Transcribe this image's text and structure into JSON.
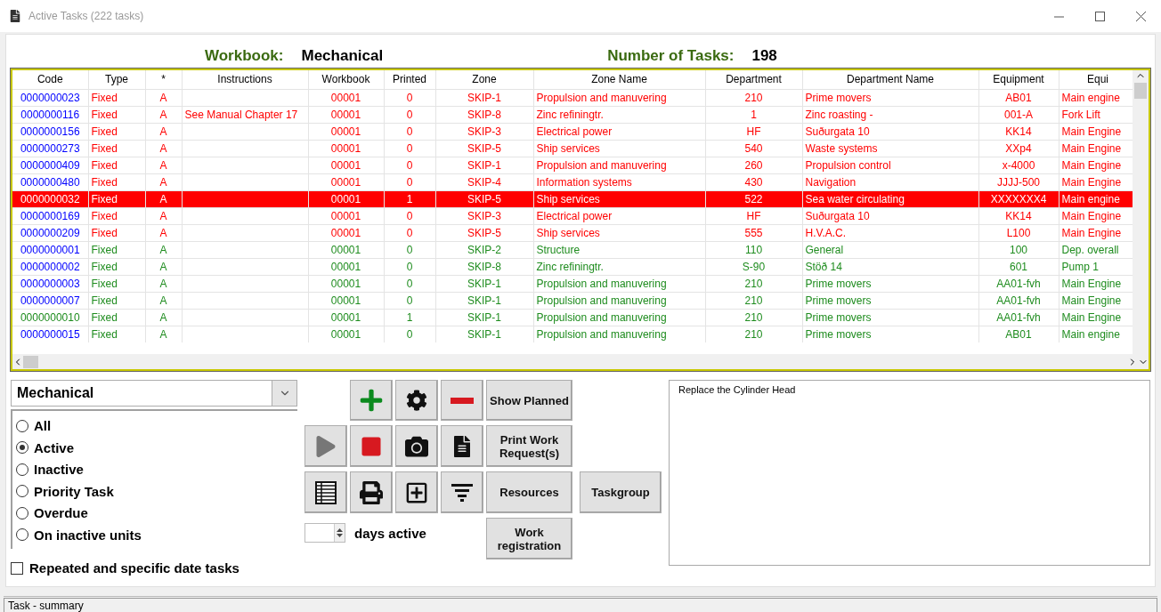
{
  "window": {
    "title": "Active Tasks (222 tasks)"
  },
  "header": {
    "workbook_label": "Workbook:",
    "workbook_value": "Mechanical",
    "count_label": "Number of Tasks:",
    "count_value": "198"
  },
  "table": {
    "columns": [
      "Code",
      "Type",
      "*",
      "Instructions",
      "Workbook",
      "Printed",
      "Zone",
      "Zone Name",
      "Department",
      "Department Name",
      "Equipment",
      "Equi"
    ],
    "rows": [
      {
        "selected": false,
        "color": "#ff0000",
        "code_highlighted": true,
        "cells": [
          "0000000023",
          "Fixed",
          "A",
          "",
          "00001",
          "0",
          "SKIP-1",
          "Propulsion and manuvering",
          "210",
          "Prime movers",
          "AB01",
          "Main engine"
        ]
      },
      {
        "selected": false,
        "color": "#ff0000",
        "code_highlighted": true,
        "cells": [
          "0000000116",
          "Fixed",
          "A",
          "See Manual Chapter 17",
          "00001",
          "0",
          "SKIP-8",
          "Zinc refiningtr.",
          "1",
          "Zinc roasting -",
          "001-A",
          "Fork Lift"
        ]
      },
      {
        "selected": false,
        "color": "#ff0000",
        "code_highlighted": true,
        "cells": [
          "0000000156",
          "Fixed",
          "A",
          "",
          "00001",
          "0",
          "SKIP-3",
          "Electrical power",
          "HF",
          "Suðurgata 10",
          "KK14",
          "Main Engine"
        ]
      },
      {
        "selected": false,
        "color": "#ff0000",
        "code_highlighted": true,
        "cells": [
          "0000000273",
          "Fixed",
          "A",
          "",
          "00001",
          "0",
          "SKIP-5",
          "Ship services",
          "540",
          "Waste systems",
          "XXp4",
          "Main Engine"
        ]
      },
      {
        "selected": false,
        "color": "#ff0000",
        "code_highlighted": true,
        "cells": [
          "0000000409",
          "Fixed",
          "A",
          "",
          "00001",
          "0",
          "SKIP-1",
          "Propulsion and manuvering",
          "260",
          "Propulsion control",
          "x-4000",
          "Main Engine"
        ]
      },
      {
        "selected": false,
        "color": "#ff0000",
        "code_highlighted": true,
        "cells": [
          "0000000480",
          "Fixed",
          "A",
          "",
          "00001",
          "0",
          "SKIP-4",
          "Information systems",
          "430",
          "Navigation",
          "JJJJ-500",
          "Main Engine"
        ]
      },
      {
        "selected": true,
        "color": "#ff0000",
        "code_highlighted": true,
        "cells": [
          "0000000032",
          "Fixed",
          "A",
          "",
          "00001",
          "1",
          "SKIP-5",
          "Ship services",
          "522",
          "Sea water circulating",
          "XXXXXXX4",
          "Main engine"
        ]
      },
      {
        "selected": false,
        "color": "#ff0000",
        "code_highlighted": true,
        "cells": [
          "0000000169",
          "Fixed",
          "A",
          "",
          "00001",
          "0",
          "SKIP-3",
          "Electrical power",
          "HF",
          "Suðurgata 10",
          "KK14",
          "Main Engine"
        ]
      },
      {
        "selected": false,
        "color": "#ff0000",
        "code_highlighted": true,
        "cells": [
          "0000000209",
          "Fixed",
          "A",
          "",
          "00001",
          "0",
          "SKIP-5",
          "Ship services",
          "555",
          "H.V.A.C.",
          "L100",
          "Main Engine"
        ]
      },
      {
        "selected": false,
        "color": "#1e8c1e",
        "code_highlighted": true,
        "cells": [
          "0000000001",
          "Fixed",
          "A",
          "",
          "00001",
          "0",
          "SKIP-2",
          "Structure",
          "110",
          "General",
          "100",
          "Dep. overall"
        ]
      },
      {
        "selected": false,
        "color": "#1e8c1e",
        "code_highlighted": true,
        "cells": [
          "0000000002",
          "Fixed",
          "A",
          "",
          "00001",
          "0",
          "SKIP-8",
          "Zinc refiningtr.",
          "S-90",
          "Stöð  14",
          "601",
          "Pump 1"
        ]
      },
      {
        "selected": false,
        "color": "#1e8c1e",
        "code_highlighted": true,
        "cells": [
          "0000000003",
          "Fixed",
          "A",
          "",
          "00001",
          "0",
          "SKIP-1",
          "Propulsion and manuvering",
          "210",
          "Prime movers",
          "AA01-fvh",
          "Main Engine"
        ]
      },
      {
        "selected": false,
        "color": "#1e8c1e",
        "code_highlighted": true,
        "cells": [
          "0000000007",
          "Fixed",
          "A",
          "",
          "00001",
          "0",
          "SKIP-1",
          "Propulsion and manuvering",
          "210",
          "Prime movers",
          "AA01-fvh",
          "Main Engine"
        ]
      },
      {
        "selected": false,
        "color": "#1e8c1e",
        "code_highlighted": false,
        "cells": [
          "0000000010",
          "Fixed",
          "A",
          "",
          "00001",
          "1",
          "SKIP-1",
          "Propulsion and manuvering",
          "210",
          "Prime movers",
          "AA01-fvh",
          "Main Engine"
        ]
      },
      {
        "selected": false,
        "color": "#1e8c1e",
        "code_highlighted": true,
        "cells": [
          "0000000015",
          "Fixed",
          "A",
          "",
          "00001",
          "0",
          "SKIP-1",
          "Propulsion and manuvering",
          "210",
          "Prime movers",
          "AB01",
          "Main engine"
        ]
      }
    ]
  },
  "workbook_select": {
    "value": "Mechanical"
  },
  "filters": [
    {
      "label": "All",
      "selected": false
    },
    {
      "label": "Active",
      "selected": true
    },
    {
      "label": "Inactive",
      "selected": false
    },
    {
      "label": "Priority Task",
      "selected": false
    },
    {
      "label": "Overdue",
      "selected": false
    },
    {
      "label": "On inactive units",
      "selected": false
    }
  ],
  "repeated_checkbox": {
    "label": "Repeated and specific date tasks",
    "checked": false
  },
  "days_active": {
    "label": "days active"
  },
  "buttons": [
    "Show Planned",
    "Print Work Request(s)",
    "Resources",
    "Taskgroup",
    "Work registration"
  ],
  "description": {
    "value": "Replace the Cylinder Head"
  },
  "status_bar": {
    "text": "Task - summary"
  }
}
